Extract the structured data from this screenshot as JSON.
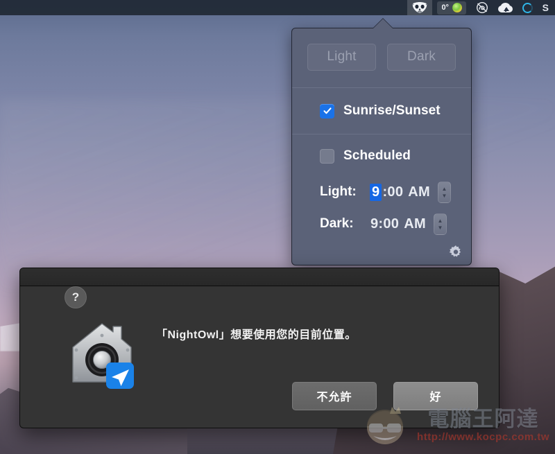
{
  "menubar": {
    "items": [
      {
        "name": "nightowl-menu-icon",
        "icon": "owl-mask-icon",
        "glyph": "🦉",
        "active": true
      },
      {
        "name": "weather-widget",
        "icon": "weather-icon",
        "temperature": "0°"
      },
      {
        "name": "creative-cloud-icon",
        "icon": "creative-cloud-icon",
        "glyph": "♾"
      },
      {
        "name": "cloud-upload-icon",
        "icon": "cloud-upload-icon"
      },
      {
        "name": "loading-ring-icon",
        "icon": "progress-ring-icon"
      },
      {
        "name": "skype-icon",
        "icon": "skype-icon",
        "glyph": "S"
      }
    ]
  },
  "popover": {
    "mode_buttons": [
      {
        "label": "Light",
        "enabled": false
      },
      {
        "label": "Dark",
        "enabled": false
      }
    ],
    "sunrise_sunset": {
      "label": "Sunrise/Sunset",
      "checked": true
    },
    "scheduled": {
      "label": "Scheduled",
      "checked": false
    },
    "schedule_rows": [
      {
        "label": "Light:",
        "selected_part": "9",
        "rest": ":00",
        "ampm": "AM",
        "highlighted": true
      },
      {
        "label": "Dark:",
        "selected_part": "",
        "rest": "9:00",
        "ampm": "AM",
        "highlighted": false
      }
    ],
    "settings_icon": "gear-icon"
  },
  "dialog": {
    "message": "「NightOwl」想要使用您的目前位置。",
    "app_icon": "security-preferences-icon",
    "badge_icon": "location-arrow-icon",
    "help_label": "?",
    "buttons": [
      {
        "label": "不允許",
        "default": false,
        "name": "dont-allow-button"
      },
      {
        "label": "好",
        "default": true,
        "name": "ok-button"
      }
    ]
  },
  "watermark": {
    "text": "電腦王阿達",
    "url": "http://www.kocpc.com.tw"
  },
  "colors": {
    "accent_blue": "#1a72e8",
    "popover_bg": "#5b6278",
    "dialog_bg": "#343434",
    "watermark_red": "#c0392b"
  }
}
